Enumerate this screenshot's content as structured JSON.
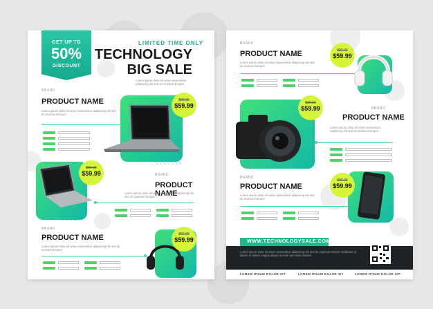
{
  "left": {
    "badge": {
      "top": "GET UP TO",
      "percent": "50%",
      "bottom": "DISCOUNT"
    },
    "limited": "LIMITED TIME ONLY",
    "title_line1": "TECHNOLOGY",
    "title_line2": "BIG SALE",
    "products": [
      {
        "brand": "BRAND",
        "name": "PRODUCT NAME",
        "old_price": "$99.99",
        "price": "$59.99",
        "desc": "Lorem ipsum dolor sit amet consectetur adipiscing elit sed do eiusmod tempor"
      },
      {
        "brand": "BRAND",
        "name": "PRODUCT NAME",
        "old_price": "$89.99",
        "price": "$59.99",
        "desc": "Lorem ipsum dolor sit amet consectetur adipiscing elit sed do eiusmod tempor"
      },
      {
        "brand": "BRAND",
        "name": "PRODUCT NAME",
        "old_price": "$99.99",
        "price": "$59.99",
        "desc": "Lorem ipsum dolor sit amet consectetur adipiscing elit sed do eiusmod tempor"
      }
    ]
  },
  "right": {
    "products": [
      {
        "brand": "BRAND",
        "name": "PRODUCT NAME",
        "old_price": "$89.99",
        "price": "$59.99",
        "desc": "Lorem ipsum dolor sit amet consectetur adipiscing elit sed do eiusmod tempor"
      },
      {
        "brand": "BRAND",
        "name": "PRODUCT NAME",
        "old_price": "$99.99",
        "price": "$59.99",
        "desc": "Lorem ipsum dolor sit amet consectetur adipiscing elit sed do eiusmod tempor"
      },
      {
        "brand": "BRAND",
        "name": "PRODUCT NAME",
        "old_price": "$89.99",
        "price": "$59.99",
        "desc": "Lorem ipsum dolor sit amet consectetur adipiscing elit sed do eiusmod tempor"
      }
    ],
    "website": "WWW.TECHNOLOGYSALE.COM",
    "band_text": "Lorem ipsum dolor sit amet consectetur adipiscing elit sed do eiusmod tempor incididunt ut labore et dolore magna aliqua ut enim ad minim veniam",
    "footer": [
      "LOREM IPSUM DOLOR SIT",
      "LOREM IPSUM DOLOR SIT",
      "LOREM IPSUM DOLOR SIT"
    ]
  },
  "colors": {
    "accent_green": "#3ed9a5",
    "lime": "#d4f53a",
    "teal": "#14b8a6",
    "dark": "#1f2326"
  },
  "icons": [
    "laptop-icon",
    "headphones-icon",
    "camera-icon",
    "smartphone-icon",
    "qr-code-icon"
  ]
}
